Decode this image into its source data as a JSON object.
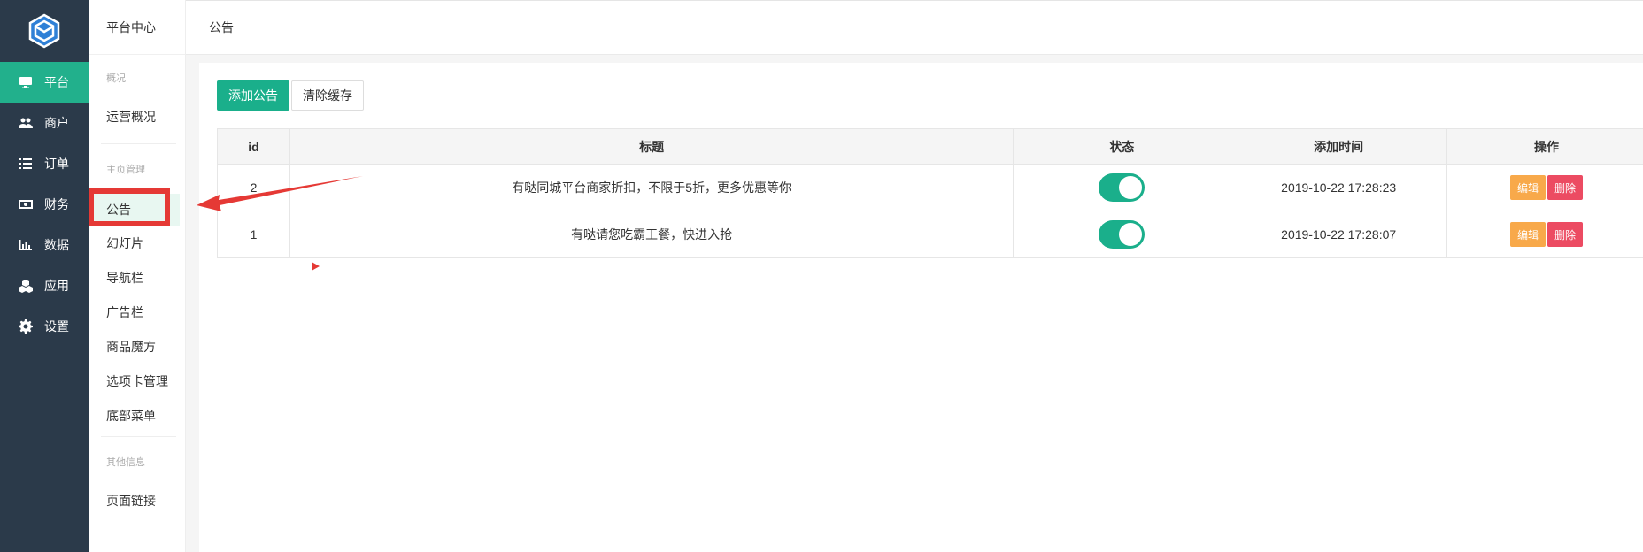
{
  "sidebar": {
    "logo": "cube-logo",
    "items": [
      {
        "label": "平台",
        "icon": "monitor-icon",
        "active": true
      },
      {
        "label": "商户",
        "icon": "users-icon"
      },
      {
        "label": "订单",
        "icon": "list-icon"
      },
      {
        "label": "财务",
        "icon": "money-icon"
      },
      {
        "label": "数据",
        "icon": "bar-chart-icon"
      },
      {
        "label": "应用",
        "icon": "cubes-icon"
      },
      {
        "label": "设置",
        "icon": "gear-icon"
      }
    ]
  },
  "submenu": {
    "header": "平台中心",
    "groups": [
      {
        "title": "概况",
        "items": [
          "运营概况"
        ]
      },
      {
        "title": "主页管理",
        "items": [
          "公告",
          "幻灯片",
          "导航栏",
          "广告栏",
          "商品魔方",
          "选项卡管理",
          "底部菜单"
        ]
      },
      {
        "title": "其他信息",
        "items": [
          "页面链接"
        ]
      }
    ],
    "active_item": "公告"
  },
  "topbar": {
    "title": "公告"
  },
  "toolbar": {
    "add_label": "添加公告",
    "clear_label": "清除缓存"
  },
  "table": {
    "columns": [
      "id",
      "标题",
      "状态",
      "添加时间",
      "操作"
    ],
    "rows": [
      {
        "id": "2",
        "title": "有哒同城平台商家折扣，不限于5折，更多优惠等你",
        "status_on": true,
        "added": "2019-10-22 17:28:23",
        "edit": "编辑",
        "delete": "删除"
      },
      {
        "id": "1",
        "title": "有哒请您吃霸王餐，快进入抢",
        "status_on": true,
        "added": "2019-10-22 17:28:07",
        "edit": "编辑",
        "delete": "删除"
      }
    ]
  },
  "colors": {
    "accent": "#1aaf8b",
    "sidebar": "#2b3a4a",
    "edit": "#f8a94a",
    "delete": "#ec4b62",
    "annotation": "#e53935"
  }
}
